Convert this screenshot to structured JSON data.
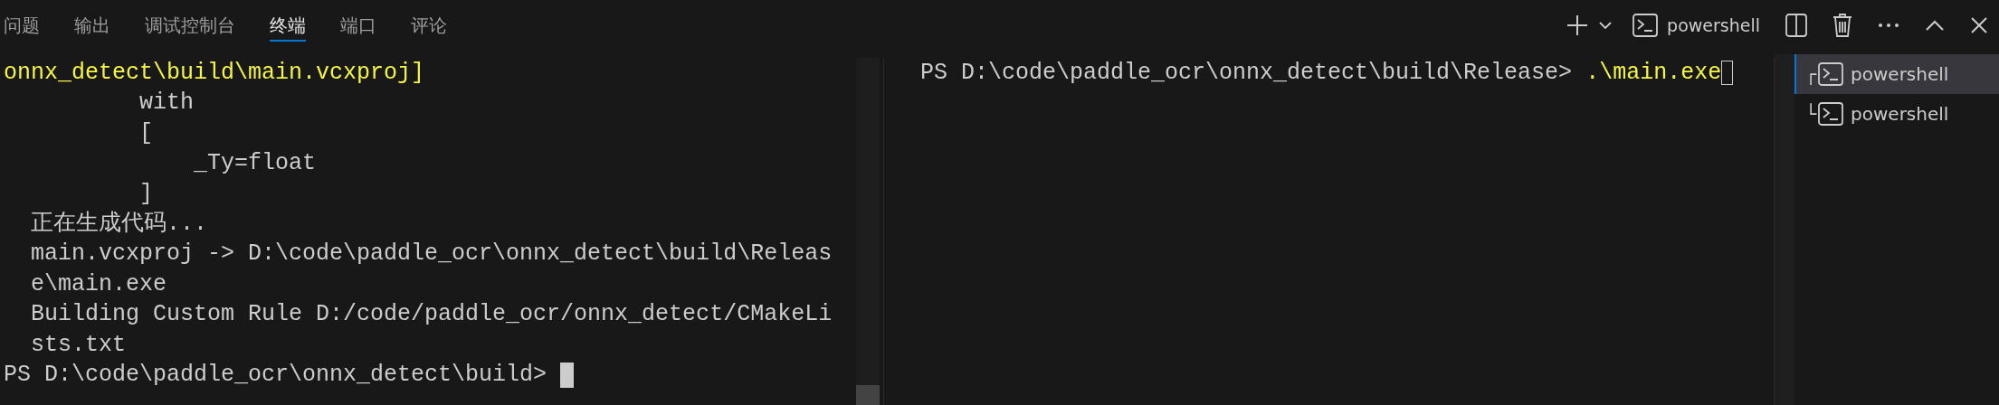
{
  "tabs": [
    {
      "label": "问题",
      "selected": false
    },
    {
      "label": "输出",
      "selected": false
    },
    {
      "label": "调试控制台",
      "selected": false
    },
    {
      "label": "终端",
      "selected": true
    },
    {
      "label": "端口",
      "selected": false
    },
    {
      "label": "评论",
      "selected": false
    }
  ],
  "toolbar": {
    "profile_label": "powershell"
  },
  "left_terminal": {
    "lines": [
      {
        "text": "onnx_detect\\build\\main.vcxproj]",
        "kind": "highlight"
      },
      {
        "text": "          with",
        "kind": "plain"
      },
      {
        "text": "          [",
        "kind": "plain"
      },
      {
        "text": "              _Ty=float",
        "kind": "plain"
      },
      {
        "text": "          ]",
        "kind": "plain"
      },
      {
        "text": "  正在生成代码...",
        "kind": "plain"
      },
      {
        "text": "  main.vcxproj -> D:\\code\\paddle_ocr\\onnx_detect\\build\\Releas",
        "kind": "plain"
      },
      {
        "text": "  e\\main.exe",
        "kind": "plain"
      },
      {
        "text": "  Building Custom Rule D:/code/paddle_ocr/onnx_detect/CMakeLi",
        "kind": "plain"
      },
      {
        "text": "  sts.txt",
        "kind": "plain"
      }
    ],
    "prompt": "PS D:\\code\\paddle_ocr\\onnx_detect\\build> "
  },
  "right_terminal": {
    "prompt": "PS D:\\code\\paddle_ocr\\onnx_detect\\build\\Release> ",
    "command": ".\\main.exe"
  },
  "terminal_list": [
    {
      "tree": "┌",
      "label": "powershell",
      "selected": true
    },
    {
      "tree": "└",
      "label": "powershell",
      "selected": false
    }
  ]
}
